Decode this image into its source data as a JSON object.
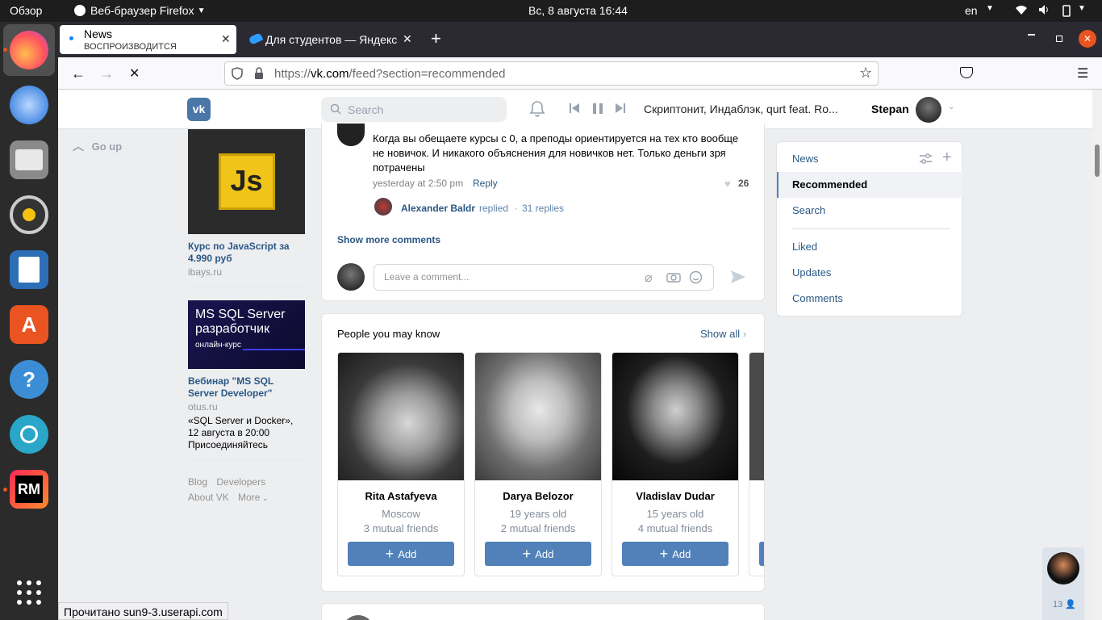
{
  "os": {
    "activities": "Обзор",
    "app_menu": "Веб-браузер Firefox",
    "clock": "Вс, 8 августа  16:44",
    "lang": "en"
  },
  "browser": {
    "tabs": [
      {
        "title": "News",
        "subtitle": "ВОСПРОИЗВОДИТСЯ"
      },
      {
        "title": "Для студентов — Яндекс"
      }
    ],
    "url_prefix": "https://",
    "url_host": "vk.com",
    "url_path": "/feed?section=recommended",
    "status_text": "Прочитано sun9-3.userapi.com"
  },
  "vk": {
    "logo": "vk",
    "search_placeholder": "Search",
    "now_playing": "Скриптонит, Индаблэк, qurt feat. Ro...",
    "user_name": "Stepan",
    "go_up": "Go up",
    "ads": [
      {
        "thumb_text": "Js",
        "title": "Курс по JavaScript за 4.990 руб",
        "domain": "ibays.ru"
      },
      {
        "thumb_text": "MS SQL Server разработчик",
        "thumb_sub": "онлайн-курс",
        "title": "Вебинар \"MS SQL Server Developer\"",
        "domain": "otus.ru",
        "text": "«SQL Server и Docker», 12 августа в 20:00 Присоединяйтесь"
      }
    ],
    "footer_links": [
      "Blog",
      "Developers",
      "About VK",
      "More"
    ],
    "comment": {
      "text": "Когда вы обещаете курсы с 0, а преподы ориентируется на тех кто вообще не новичок. И никакого объяснения для новичков нет. Только деньги зря потрачены",
      "time": "yesterday at 2:50 pm",
      "reply": "Reply",
      "likes": "26",
      "replier": "Alexander Baldr",
      "replied": "replied",
      "replies": "31 replies",
      "show_more": "Show more comments",
      "placeholder": "Leave a comment..."
    },
    "people": {
      "title": "People you may know",
      "show_all": "Show all",
      "add_label": "Add",
      "items": [
        {
          "name": "Rita Astafyeva",
          "line1": "Moscow",
          "line2": "3 mutual friends"
        },
        {
          "name": "Darya Belozor",
          "line1": "19 years old",
          "line2": "2 mutual friends"
        },
        {
          "name": "Vladislav Dudar",
          "line1": "15 years old",
          "line2": "4 mutual friends"
        }
      ]
    },
    "right_menu": {
      "news": "News",
      "recommended": "Recommended",
      "search": "Search",
      "liked": "Liked",
      "updates": "Updates",
      "comments": "Comments"
    },
    "chat_count": "13"
  },
  "colors": {
    "vk_blue": "#2a5885",
    "button_blue": "#5181b8",
    "ubuntu_orange": "#e95420"
  }
}
